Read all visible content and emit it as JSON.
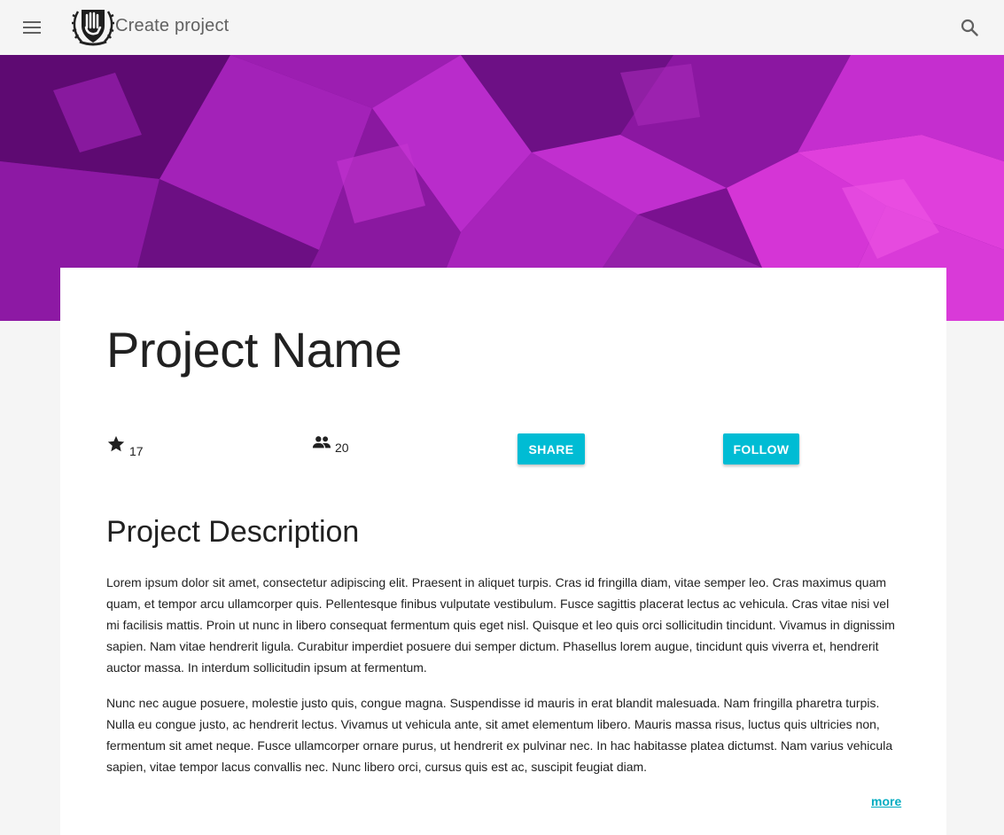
{
  "topbar": {
    "title": "Create project",
    "menu_icon": "menu-icon",
    "search_icon": "search-icon",
    "logo": "crest-logo"
  },
  "hero": {
    "style": "purple-magenta low-poly background",
    "colors": [
      "#5a0a6e",
      "#8e1aa8",
      "#c81ec8",
      "#e22bd6"
    ]
  },
  "project": {
    "name": "Project Name",
    "stars": "17",
    "members": "20",
    "star_icon": "star-icon",
    "members_icon": "people-icon",
    "share_label": "SHARE",
    "follow_label": "FOLLOW"
  },
  "description": {
    "title": "Project Description",
    "paragraphs": [
      "Lorem ipsum dolor sit amet, consectetur adipiscing elit. Praesent in aliquet turpis. Cras id fringilla diam, vitae semper leo. Cras maximus quam quam, et tempor arcu ullamcorper quis. Pellentesque finibus vulputate vestibulum. Fusce sagittis placerat lectus ac vehicula. Cras vitae nisi vel mi facilisis mattis. Proin ut nunc in libero consequat fermentum quis eget nisl. Quisque et leo quis orci sollicitudin tincidunt. Vivamus in dignissim sapien. Nam vitae hendrerit ligula. Curabitur imperdiet posuere dui semper dictum. Phasellus lorem augue, tincidunt quis viverra et, hendrerit auctor massa. In interdum sollicitudin ipsum at fermentum.",
      "Nunc nec augue posuere, molestie justo quis, congue magna. Suspendisse id mauris in erat blandit malesuada. Nam fringilla pharetra turpis. Nulla eu congue justo, ac hendrerit lectus. Vivamus ut vehicula ante, sit amet elementum libero. Mauris massa risus, luctus quis ultricies non, fermentum sit amet neque. Fusce ullamcorper ornare purus, ut hendrerit ex pulvinar nec. In hac habitasse platea dictumst. Nam varius vehicula sapien, vitae tempor lacus convallis nec. Nunc libero orci, cursus quis est ac, suscipit feugiat diam."
    ],
    "more_label": "more"
  },
  "theme": {
    "accent": "#00bcd4",
    "link": "#00acc1",
    "background": "#f5f5f5"
  }
}
